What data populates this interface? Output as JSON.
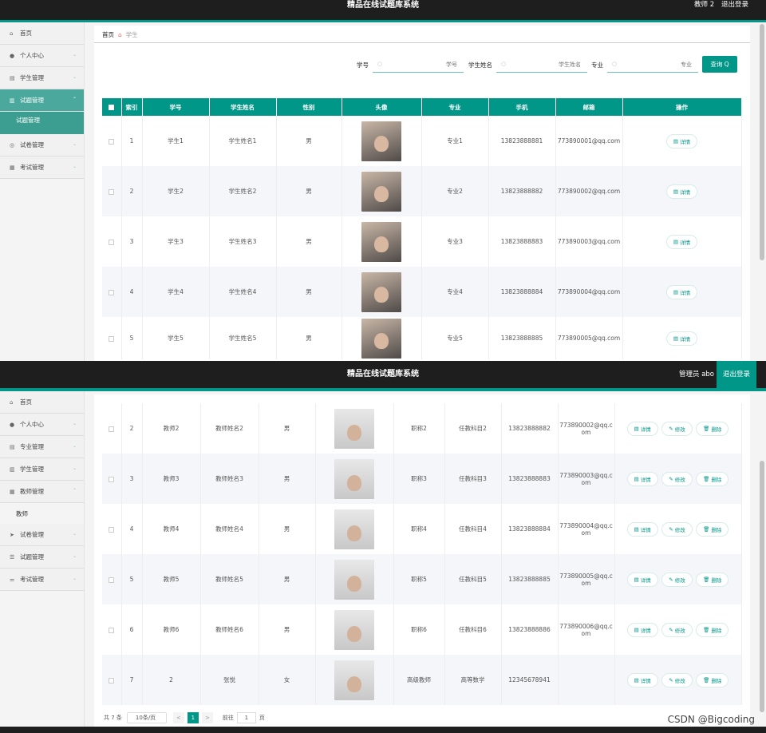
{
  "app_title": "精品在线试题库系统",
  "panel1": {
    "user": "教师 2",
    "logout": "退出登录",
    "menu": [
      {
        "icon": "home-icon",
        "label": "首页",
        "chev": ""
      },
      {
        "icon": "user-icon",
        "label": "个人中心",
        "chev": "⌄"
      },
      {
        "icon": "card-icon",
        "label": "学生管理",
        "chev": "⌄"
      },
      {
        "icon": "building-icon",
        "label": "试题管理",
        "chev": "⌃",
        "active": true
      }
    ],
    "submenu": "试题管理",
    "menu2": [
      {
        "icon": "globe-icon",
        "label": "试卷管理",
        "chev": "⌄"
      },
      {
        "icon": "doc-icon",
        "label": "考试管理",
        "chev": "⌄"
      }
    ],
    "breadcrumb": {
      "home": "首页",
      "current": "学生"
    },
    "search": [
      {
        "label": "学号",
        "placeholder": "学号"
      },
      {
        "label": "学生姓名",
        "placeholder": "学生姓名"
      },
      {
        "label": "专业",
        "placeholder": "专业"
      }
    ],
    "query_btn": "查询 Q",
    "columns": [
      "",
      "索引",
      "学号",
      "学生姓名",
      "性别",
      "头像",
      "专业",
      "手机",
      "邮箱",
      "操作"
    ],
    "rows": [
      {
        "idx": "1",
        "no": "学生1",
        "name": "学生姓名1",
        "sex": "男",
        "major": "专业1",
        "phone": "13823888881",
        "email": "773890001@qq.com",
        "op": "详情"
      },
      {
        "idx": "2",
        "no": "学生2",
        "name": "学生姓名2",
        "sex": "男",
        "major": "专业2",
        "phone": "13823888882",
        "email": "773890002@qq.com",
        "op": "详情"
      },
      {
        "idx": "3",
        "no": "学生3",
        "name": "学生姓名3",
        "sex": "男",
        "major": "专业3",
        "phone": "13823888883",
        "email": "773890003@qq.com",
        "op": "详情"
      },
      {
        "idx": "4",
        "no": "学生4",
        "name": "学生姓名4",
        "sex": "男",
        "major": "专业4",
        "phone": "13823888884",
        "email": "773890004@qq.com",
        "op": "详情"
      },
      {
        "idx": "5",
        "no": "学生5",
        "name": "学生姓名5",
        "sex": "男",
        "major": "专业5",
        "phone": "13823888885",
        "email": "773890005@qq.com",
        "op": "详情"
      }
    ]
  },
  "panel2": {
    "user": "管理员 abo",
    "logout": "退出登录",
    "menu": [
      {
        "icon": "home-icon",
        "label": "首页",
        "chev": ""
      },
      {
        "icon": "user-icon",
        "label": "个人中心",
        "chev": "⌄"
      },
      {
        "icon": "card-icon",
        "label": "专业管理",
        "chev": "⌄"
      },
      {
        "icon": "building-icon",
        "label": "学生管理",
        "chev": "⌄"
      },
      {
        "icon": "doc-icon",
        "label": "教师管理",
        "chev": "⌃"
      }
    ],
    "submenu": "教师",
    "menu2": [
      {
        "icon": "send-icon",
        "label": "试卷管理",
        "chev": "⌄"
      },
      {
        "icon": "list-icon",
        "label": "试题管理",
        "chev": "⌄"
      },
      {
        "icon": "sliders-icon",
        "label": "考试管理",
        "chev": "⌄"
      }
    ],
    "rows": [
      {
        "idx": "2",
        "no": "教师2",
        "name": "教师姓名2",
        "sex": "男",
        "title": "职称2",
        "subject": "任教科目2",
        "phone": "13823888882",
        "email": "773890002@qq.com"
      },
      {
        "idx": "3",
        "no": "教师3",
        "name": "教师姓名3",
        "sex": "男",
        "title": "职称3",
        "subject": "任教科目3",
        "phone": "13823888883",
        "email": "773890003@qq.com"
      },
      {
        "idx": "4",
        "no": "教师4",
        "name": "教师姓名4",
        "sex": "男",
        "title": "职称4",
        "subject": "任教科目4",
        "phone": "13823888884",
        "email": "773890004@qq.com"
      },
      {
        "idx": "5",
        "no": "教师5",
        "name": "教师姓名5",
        "sex": "男",
        "title": "职称5",
        "subject": "任教科目5",
        "phone": "13823888885",
        "email": "773890005@qq.com"
      },
      {
        "idx": "6",
        "no": "教师6",
        "name": "教师姓名6",
        "sex": "男",
        "title": "职称6",
        "subject": "任教科目6",
        "phone": "13823888886",
        "email": "773890006@qq.com"
      },
      {
        "idx": "7",
        "no": "2",
        "name": "张悦",
        "sex": "女",
        "title": "高级教师",
        "subject": "高等数学",
        "phone": "12345678941",
        "email": ""
      }
    ],
    "ops": {
      "detail": "详情",
      "edit": "修改",
      "delete": "删除"
    },
    "pager": {
      "total": "共 7 条",
      "size": "10条/页",
      "prev": "<",
      "page": "1",
      "next": ">",
      "goto": "前往",
      "page_input": "1",
      "page_unit": "页"
    }
  },
  "watermark": "CSDN @Bigcoding"
}
